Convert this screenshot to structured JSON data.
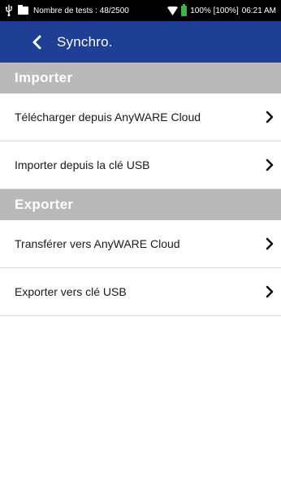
{
  "status_bar": {
    "tests_text": "Nombre de tests : 48/2500",
    "battery_text": "100% [100%]",
    "time": "06:21 AM",
    "battery_color": "#3db34a",
    "icons": [
      "usb-icon",
      "folder-icon",
      "wifi-icon",
      "battery-icon"
    ]
  },
  "header": {
    "title": "Synchro.",
    "background": "#1f3f95",
    "back_icon": "chevron-left-icon"
  },
  "sections": [
    {
      "title": "Importer",
      "items": [
        {
          "label": "Télécharger depuis AnyWARE Cloud",
          "icon": "chevron-right-icon"
        },
        {
          "label": "Importer depuis la clé USB",
          "icon": "chevron-right-icon"
        }
      ]
    },
    {
      "title": "Exporter",
      "items": [
        {
          "label": "Transférer vers AnyWARE Cloud",
          "icon": "chevron-right-icon"
        },
        {
          "label": "Exporter vers clé USB",
          "icon": "chevron-right-icon"
        }
      ]
    }
  ],
  "colors": {
    "section_header_bg": "#b9b9b9",
    "divider": "#d6d6d6"
  }
}
